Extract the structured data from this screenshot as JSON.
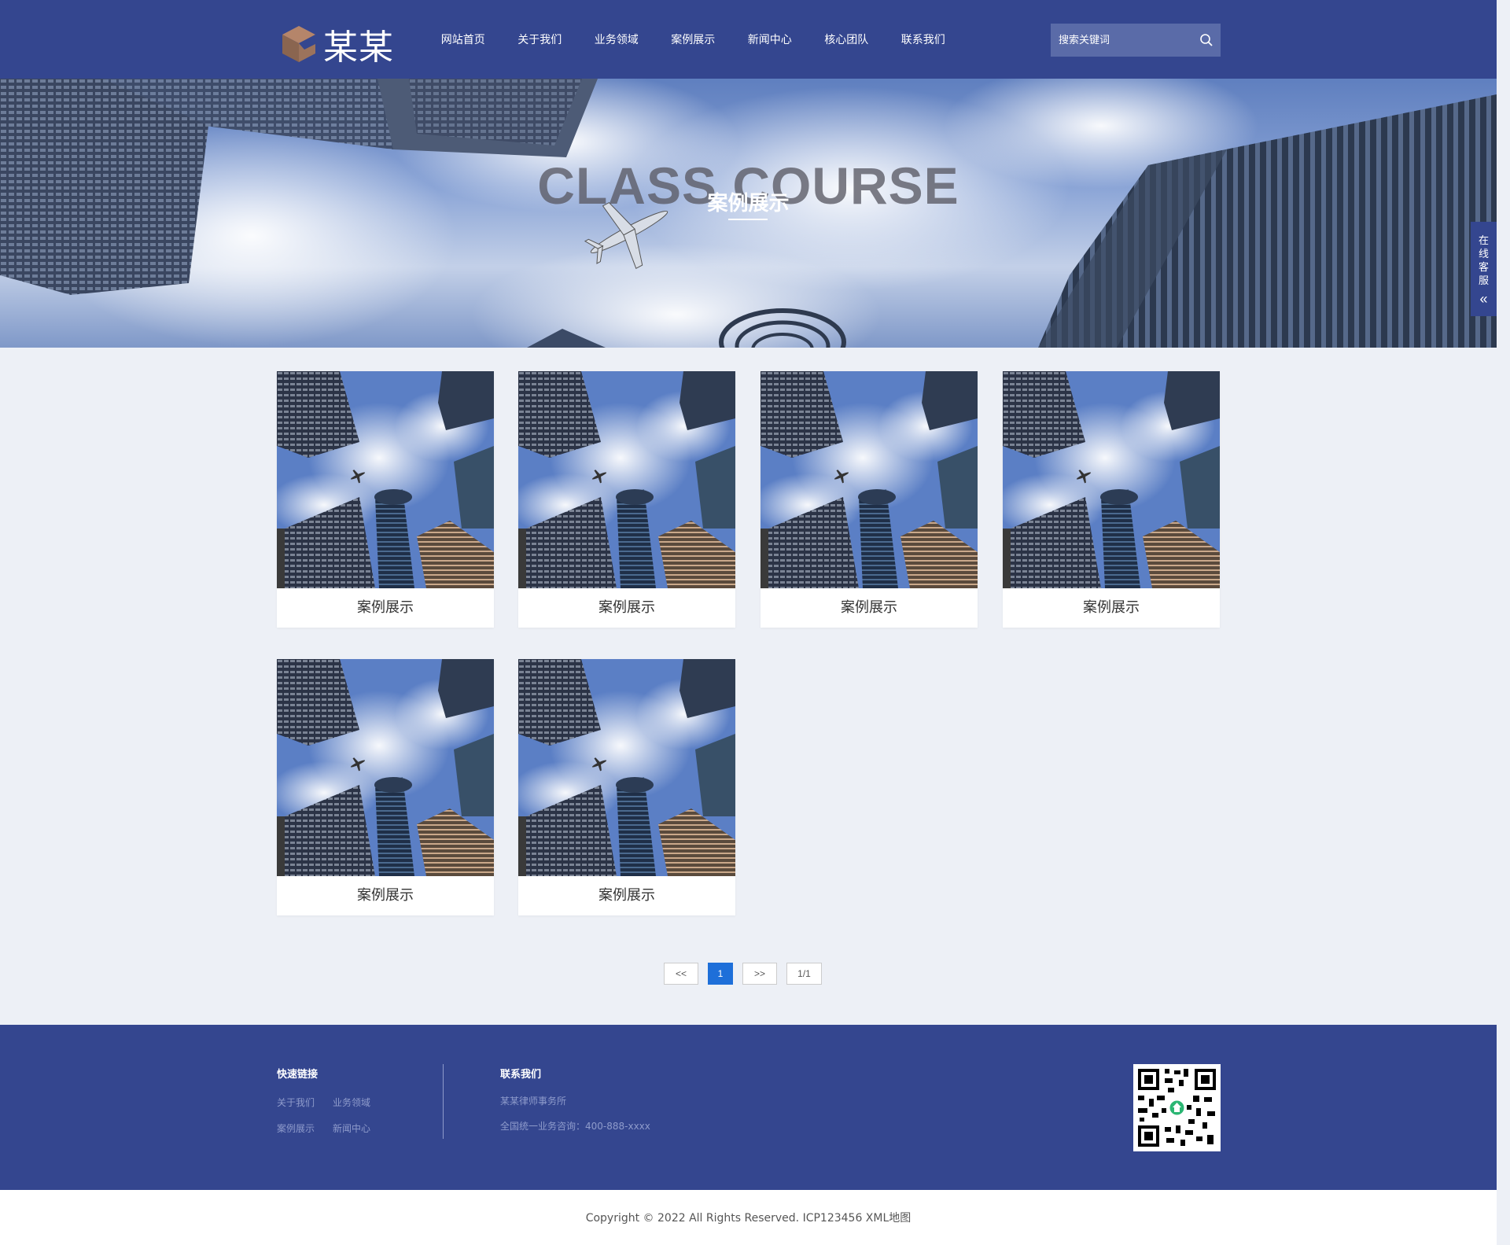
{
  "header": {
    "logo_text": "某某",
    "nav": [
      "网站首页",
      "关于我们",
      "业务领域",
      "案例展示",
      "新闻中心",
      "核心团队",
      "联系我们"
    ],
    "search_placeholder": "搜索关键词"
  },
  "banner": {
    "title_en": "CLASS COURSE",
    "title_cn": "案例展示"
  },
  "side_service": {
    "chars": [
      "在",
      "线",
      "客",
      "服"
    ],
    "arrow": "«"
  },
  "cases": [
    {
      "title": "案例展示"
    },
    {
      "title": "案例展示"
    },
    {
      "title": "案例展示"
    },
    {
      "title": "案例展示"
    },
    {
      "title": "案例展示"
    },
    {
      "title": "案例展示"
    }
  ],
  "pagination": {
    "prev": "<<",
    "current": "1",
    "next": ">>",
    "summary": "1/1"
  },
  "footer": {
    "quick_links_heading": "快速链接",
    "quick_links": [
      "关于我们",
      "业务领域",
      "案例展示",
      "新闻中心"
    ],
    "contact_heading": "联系我们",
    "firm": "某某律师事务所",
    "hotline": "全国统一业务咨询：400-888-xxxx",
    "copyright": "Copyright © 2022 All Rights Reserved. ICP123456 XML地图"
  },
  "colors": {
    "brand": "#34468f",
    "accent": "#1e6fd9",
    "page_bg": "#edf0f6"
  }
}
